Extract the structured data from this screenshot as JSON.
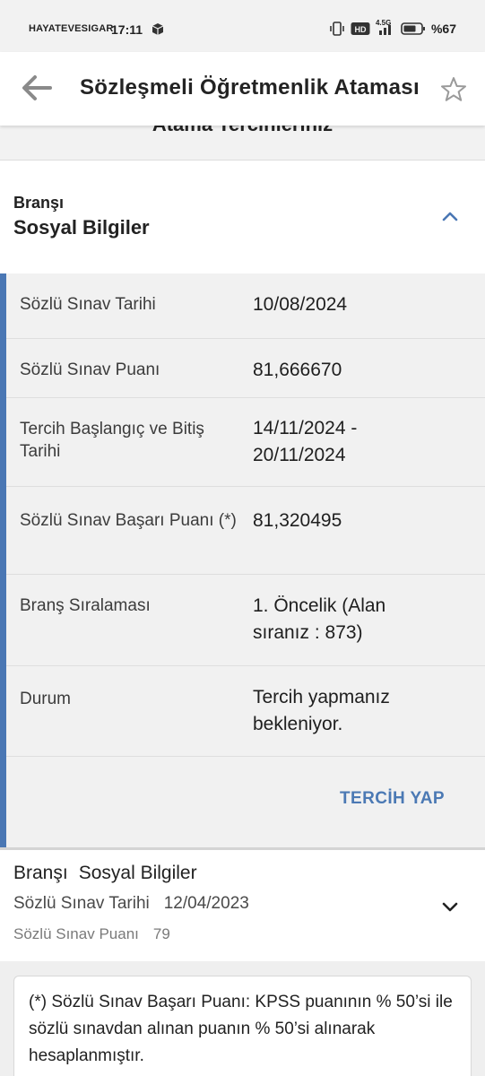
{
  "status_bar": {
    "carrier": "HAYATEVESIGAR",
    "time": "17:11",
    "network": "4.5G",
    "battery_pct": "%67"
  },
  "app_bar": {
    "title": "Sözleşmeli Öğretmenlik Ataması",
    "back_icon": "arrow-left-icon",
    "star_icon": "star-outline-icon"
  },
  "section_heading": "Atama Tercihleriniz",
  "branch": {
    "label": "Branşı",
    "value": "Sosyal Bilgiler",
    "chevron_icon": "chevron-up-icon"
  },
  "details": [
    {
      "key": "Sözlü Sınav Tarihi",
      "value": "10/08/2024"
    },
    {
      "key": "Sözlü Sınav Puanı",
      "value": "81,666670"
    },
    {
      "key": "Tercih Başlangıç ve Bitiş Tarihi",
      "value": "14/11/2024 - 20/11/2024"
    },
    {
      "key": "Sözlü Sınav Başarı Puanı (*)",
      "value": "81,320495"
    },
    {
      "key": "Branş Sıralaması",
      "value": "1. Öncelik (Alan sıranız : 873)"
    },
    {
      "key": "Durum",
      "value": "Tercih yapmanız bekleniyor."
    }
  ],
  "action_button": "TERCİH YAP",
  "previous_branch": {
    "label": "Branşı",
    "value": "Sosyal Bilgiler",
    "date_label": "Sözlü Sınav Tarihi",
    "date_value": "12/04/2023",
    "score_label": "Sözlü Sınav Puanı",
    "score_value": "79",
    "chevron_icon": "chevron-down-icon"
  },
  "footnote": "(*) Sözlü Sınav Başarı Puanı: KPSS puanının % 50’si ile sözlü sınavdan alınan puanın % 50’si alınarak hesaplanmıştır.",
  "colors": {
    "accent": "#4a77b4",
    "button_text": "#4b79b4"
  }
}
